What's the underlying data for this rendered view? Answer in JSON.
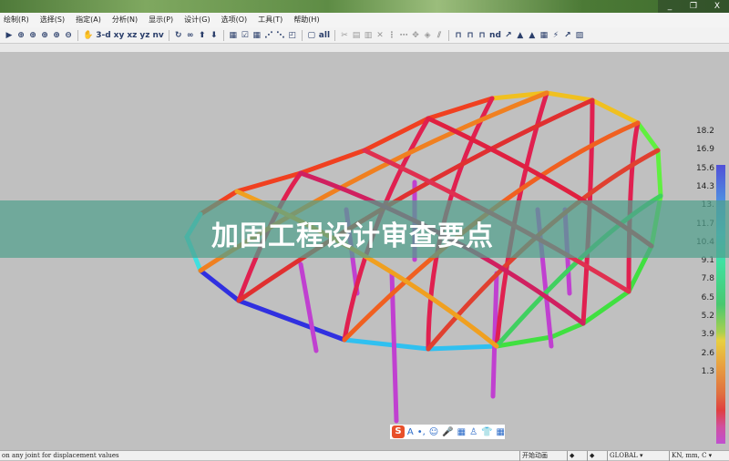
{
  "window": {
    "minimize": "_",
    "restore": "❐",
    "close": "X"
  },
  "menu": [
    "绘制(R)",
    "选择(S)",
    "指定(A)",
    "分析(N)",
    "显示(P)",
    "设计(G)",
    "选项(O)",
    "工具(T)",
    "帮助(H)"
  ],
  "toolbar": [
    "▶",
    "⊕",
    "⊕",
    "⊕",
    "⊕",
    "⊖",
    "✋",
    "3-d",
    "xy",
    "xz",
    "yz",
    "nv",
    "↻",
    "∞",
    "⬆",
    "⬇",
    "▦",
    "☑",
    "▦",
    "⋰",
    "⋱",
    "◰",
    "▢",
    "all",
    "✂",
    "▤",
    "▥",
    "✕",
    "⋮",
    "⋯",
    "✥",
    "◈",
    "⫽",
    "⊓",
    "⊓",
    "⊓",
    "nd",
    "↗",
    "▲",
    "▲",
    "▦",
    "⚡",
    "↗",
    "▨"
  ],
  "legend": {
    "values": [
      "18.2",
      "16.9",
      "15.6",
      "14.3",
      "13.",
      "11.7",
      "10.4",
      "9.1",
      "7.8",
      "6.5",
      "5.2",
      "3.9",
      "2.6",
      "1.3"
    ]
  },
  "banner": {
    "title": "加固工程设计审查要点"
  },
  "ime": {
    "logo": "S",
    "items": [
      "A",
      "•,",
      "☺",
      "🎤",
      "▦",
      "♙",
      "👕",
      "▦"
    ]
  },
  "status": {
    "message": "on any joint for displacement values",
    "animate": "开始动画",
    "prev": "◆",
    "next": "◆",
    "coord": "GLOBAL",
    "units": "KN, mm, C"
  }
}
